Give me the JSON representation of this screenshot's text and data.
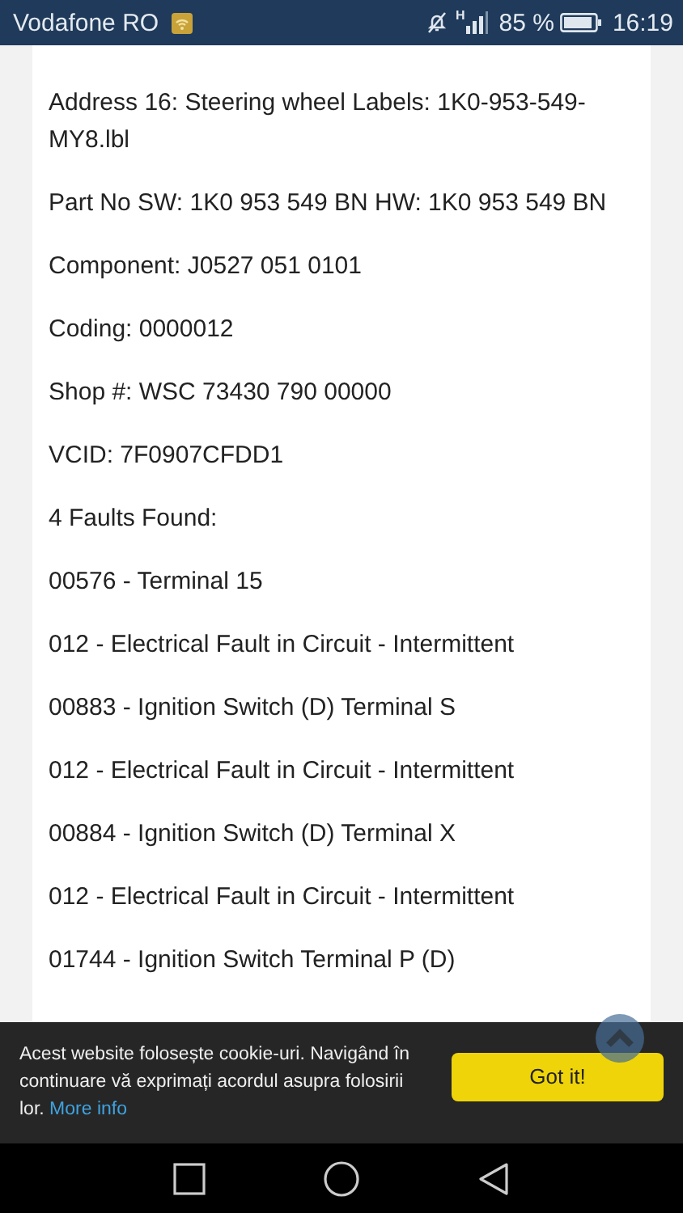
{
  "status_bar": {
    "carrier": "Vodafone RO",
    "battery_percent": "85 %",
    "time": "16:19",
    "network_type": "H"
  },
  "article": {
    "paragraphs": [
      "Address 16: Steering wheel Labels: 1K0-953-549-MY8.lbl",
      "Part No SW: 1K0 953 549 BN HW: 1K0 953 549 BN",
      "Component: J0527 051 0101",
      "Coding: 0000012",
      "Shop #: WSC 73430 790 00000",
      "VCID: 7F0907CFDD1",
      "4 Faults Found:",
      "00576 - Terminal 15",
      "012 - Electrical Fault in Circuit - Intermittent",
      "00883 - Ignition Switch (D) Terminal S",
      "012 - Electrical Fault in Circuit - Intermittent",
      "00884 - Ignition Switch (D) Terminal X",
      "012 - Electrical Fault in Circuit - Intermittent",
      "01744 - Ignition Switch Terminal P (D)"
    ]
  },
  "cookie_banner": {
    "message": "Acest website folosește cookie-uri. Navigând în continuare vă exprimați acordul asupra folosirii lor.",
    "link": "More info",
    "button": "Got it!"
  }
}
